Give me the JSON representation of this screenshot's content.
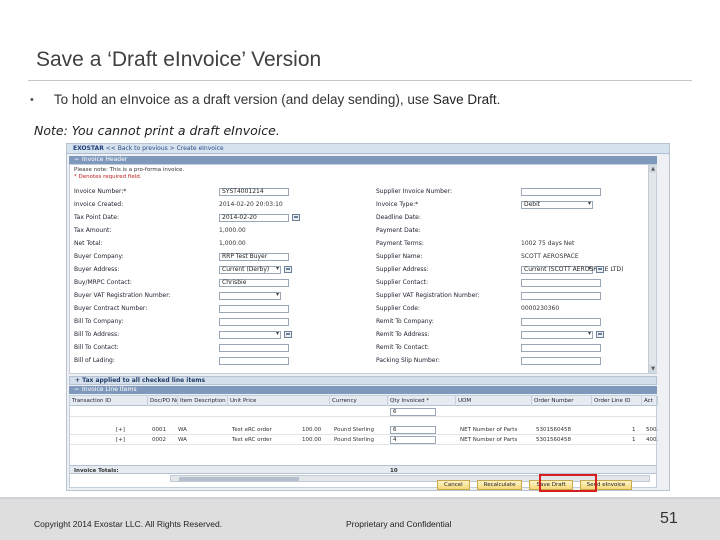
{
  "slide": {
    "title": "Save a ‘Draft eInvoice’ Version",
    "bullet": "•",
    "bullet_text_prefix": "To hold an eInvoice as a draft version (and delay sending), use ",
    "bullet_text_strong": "Save Draft",
    "bullet_text_suffix": ".",
    "note": "Note:  You cannot print a draft eInvoice."
  },
  "app": {
    "brand": "EXOSTAR",
    "breadcrumb": "<< Back to previous  >  Create eInvoice",
    "header_section_title": "Invoice Header",
    "header_notes": [
      "Please note: This is a pro-forma invoice.",
      "* Denotes required field."
    ],
    "left_fields": [
      {
        "label": "Invoice Number:*",
        "value": "SYST4001214",
        "kind": "input"
      },
      {
        "label": "Invoice Created:",
        "value": "2014-02-20 20:03:10",
        "kind": "text"
      },
      {
        "label": "Tax Point Date:",
        "value": "2014-02-20",
        "kind": "date"
      },
      {
        "label": "Tax Amount:",
        "value": "1,000.00",
        "kind": "text"
      },
      {
        "label": "Net Total:",
        "value": "1,000.00",
        "kind": "text"
      },
      {
        "label": "Buyer Company:",
        "value": "RRP Test Buyer",
        "kind": "input"
      },
      {
        "label": "Buyer Address:",
        "value": "Current (Derby)",
        "kind": "select"
      },
      {
        "label": "Buy/MRPC Contact:",
        "value": "Chrisbie",
        "kind": "input"
      },
      {
        "label": "Buyer VAT Registration Number:",
        "value": "",
        "kind": "select"
      },
      {
        "label": "Buyer Contract Number:",
        "value": "",
        "kind": "input"
      },
      {
        "label": "Bill To Company:",
        "value": "",
        "kind": "input"
      },
      {
        "label": "Bill To Address:",
        "value": "",
        "kind": "select"
      },
      {
        "label": "Bill To Contact:",
        "value": "",
        "kind": "input"
      },
      {
        "label": "Bill of Lading:",
        "value": "",
        "kind": "input"
      }
    ],
    "right_fields": [
      {
        "label": "Supplier Invoice Number:",
        "value": "",
        "kind": "input"
      },
      {
        "label": "Invoice Type:*",
        "value": "Debit",
        "kind": "select"
      },
      {
        "label": "Deadline Date:",
        "value": "",
        "kind": "text"
      },
      {
        "label": "Payment Date:",
        "value": "",
        "kind": "text"
      },
      {
        "label": "Payment Terms:",
        "value": "1002 75 days Net",
        "kind": "text"
      },
      {
        "label": "Supplier Name:",
        "value": "SCOTT AEROSPACE",
        "kind": "text"
      },
      {
        "label": "Supplier Address:",
        "value": "Current (SCOTT AEROSPACE LTD)",
        "kind": "select"
      },
      {
        "label": "Supplier Contact:",
        "value": "",
        "kind": "input"
      },
      {
        "label": "Supplier VAT Registration Number:",
        "value": "",
        "kind": "input"
      },
      {
        "label": "Supplier Code:",
        "value": "0000230360",
        "kind": "text"
      },
      {
        "label": "Remit To Company:",
        "value": "",
        "kind": "input"
      },
      {
        "label": "Remit To Address:",
        "value": "",
        "kind": "select"
      },
      {
        "label": "Remit To Contact:",
        "value": "",
        "kind": "input"
      },
      {
        "label": "Packing Slip Number:",
        "value": "",
        "kind": "input"
      }
    ],
    "tax_bar": "Tax applied to all checked line items",
    "lines_section_title": "Invoice Line Items",
    "columns": [
      "Transaction ID",
      "Doc/PO No.",
      "Item Description",
      "Unit Price",
      "Currency",
      "Qty Invoiced *",
      "UOM",
      "Order Number",
      "Order Line ID",
      "Act"
    ],
    "rows": [
      {
        "txn": "",
        "po": "",
        "desc": "",
        "price": "",
        "cur": "",
        "qty": "6",
        "uom": "",
        "order": "",
        "line": "",
        "act": ""
      },
      {
        "txn": "[+]",
        "po": "0001",
        "desc": "WA",
        "item": "Test eRC order",
        "price": "100.00",
        "cur": "Pound Sterling",
        "qty": "6",
        "uom": "NET Number of Parts",
        "order": "5301560458",
        "line": "1",
        "act": "500."
      },
      {
        "txn": "[+]",
        "po": "0002",
        "desc": "WA",
        "item": "Test eRC order",
        "price": "100.00",
        "cur": "Pound Sterling",
        "qty": "4",
        "uom": "NET Number of Parts",
        "order": "5301560458",
        "line": "1",
        "act": "400."
      }
    ],
    "totals_label": "Invoice Totals:",
    "totals_qty": "10",
    "buttons": {
      "cancel": "Cancel",
      "recalculate": "Recalculate",
      "save_draft": "Save Draft",
      "send": "Send eInvoice"
    }
  },
  "footer": {
    "copyright": "Copyright 2014 Exostar LLC. All Rights Reserved.",
    "proprietary": "Proprietary and Confidential",
    "page": "51"
  },
  "colors": {
    "highlight": "#d62020",
    "section_header": "#7f99bd"
  }
}
